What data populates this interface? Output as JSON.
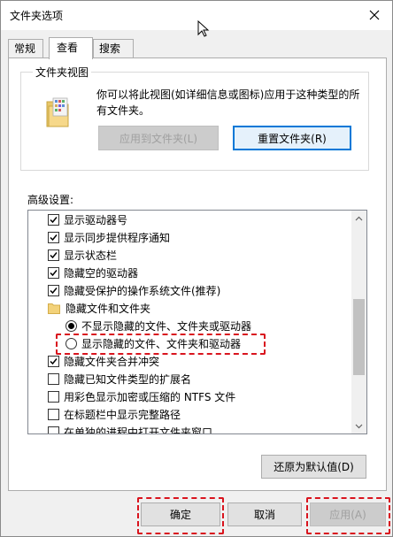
{
  "window": {
    "title": "文件夹选项"
  },
  "tabs": [
    {
      "label": "常规"
    },
    {
      "label": "查看",
      "active": true
    },
    {
      "label": "搜索"
    }
  ],
  "folder_views": {
    "legend": "文件夹视图",
    "description": "你可以将此视图(如详细信息或图标)应用于这种类型的所有文件夹。",
    "apply_button": "应用到文件夹(L)",
    "reset_button": "重置文件夹(R)"
  },
  "advanced": {
    "label": "高级设置:",
    "items": [
      {
        "type": "checkbox",
        "checked": true,
        "label": "显示驱动器号"
      },
      {
        "type": "checkbox",
        "checked": true,
        "label": "显示同步提供程序通知"
      },
      {
        "type": "checkbox",
        "checked": true,
        "label": "显示状态栏"
      },
      {
        "type": "checkbox",
        "checked": true,
        "label": "隐藏空的驱动器"
      },
      {
        "type": "checkbox",
        "checked": true,
        "label": "隐藏受保护的操作系统文件(推荐)"
      },
      {
        "type": "folder",
        "label": "隐藏文件和文件夹"
      },
      {
        "type": "radio",
        "checked": true,
        "label": "不显示隐藏的文件、文件夹或驱动器"
      },
      {
        "type": "radio",
        "checked": false,
        "label": "显示隐藏的文件、文件夹和驱动器"
      },
      {
        "type": "checkbox",
        "checked": true,
        "label": "隐藏文件夹合并冲突"
      },
      {
        "type": "checkbox",
        "checked": false,
        "label": "隐藏已知文件类型的扩展名"
      },
      {
        "type": "checkbox",
        "checked": false,
        "label": "用彩色显示加密或压缩的 NTFS 文件"
      },
      {
        "type": "checkbox",
        "checked": false,
        "label": "在标题栏中显示完整路径"
      },
      {
        "type": "checkbox",
        "checked": false,
        "label": "在单独的进程中打开文件夹窗口"
      }
    ],
    "restore_defaults": "还原为默认值(D)"
  },
  "footer": {
    "ok": "确定",
    "cancel": "取消",
    "apply": "应用(A)"
  },
  "colors": {
    "highlight": "#d9141e",
    "focus": "#0078d7"
  }
}
